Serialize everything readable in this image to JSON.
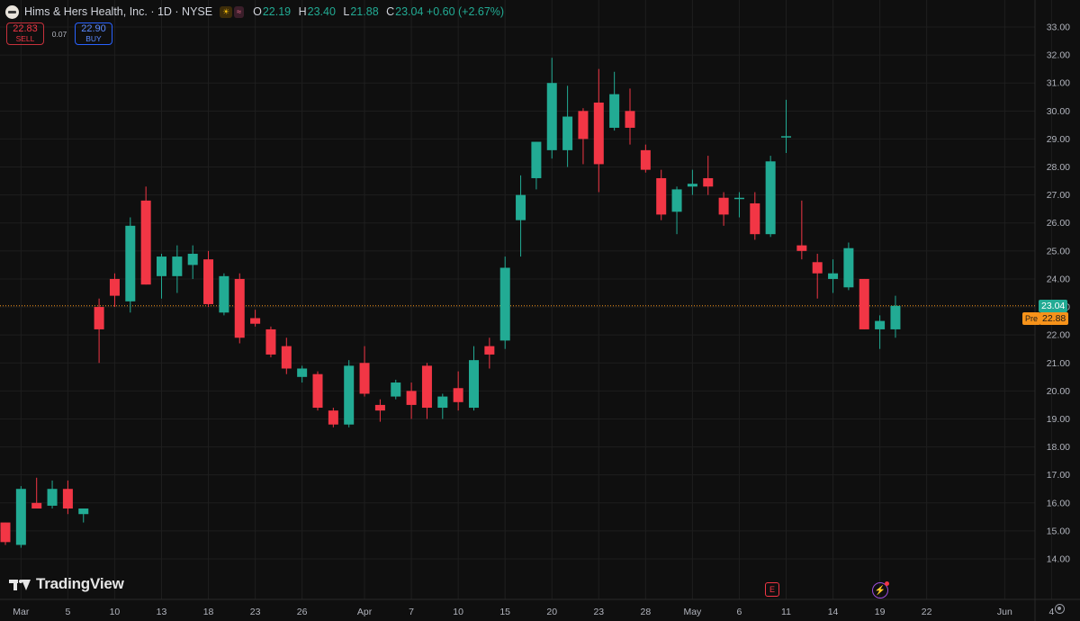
{
  "header": {
    "title": "Hims & Hers Health, Inc. · 1D · NYSE",
    "ohlc": [
      {
        "k": "O",
        "v": "22.19"
      },
      {
        "k": "H",
        "v": "23.40"
      },
      {
        "k": "L",
        "v": "21.88"
      },
      {
        "k": "C",
        "v": "23.04 +0.60 (+2.67%)"
      }
    ]
  },
  "trade": {
    "sell_price": "22.83",
    "sell_label": "SELL",
    "spread": "0.07",
    "buy_price": "22.90",
    "buy_label": "BUY"
  },
  "price_labels": {
    "last": "23.04",
    "pre_tag": "Pre",
    "pre": "22.88"
  },
  "branding": {
    "logo_text": "TradingView"
  },
  "events": {
    "earnings": "E"
  },
  "colors": {
    "up": "#22ab94",
    "down": "#f23645",
    "background": "#0f0f0f",
    "grid": "#1e1e1e",
    "pre": "#f7931a"
  },
  "chart_data": {
    "type": "candlestick",
    "ylim": [
      13.5,
      33.3
    ],
    "y_ticks": [
      "14.00",
      "15.00",
      "16.00",
      "17.00",
      "18.00",
      "19.00",
      "20.00",
      "21.00",
      "22.00",
      "23.00",
      "24.00",
      "25.00",
      "26.00",
      "27.00",
      "28.00",
      "29.00",
      "30.00",
      "31.00",
      "32.00",
      "33.00"
    ],
    "x_ticks": [
      {
        "i": 1,
        "label": "Mar"
      },
      {
        "i": 4,
        "label": "5"
      },
      {
        "i": 7,
        "label": "10"
      },
      {
        "i": 10,
        "label": "13"
      },
      {
        "i": 13,
        "label": "18"
      },
      {
        "i": 16,
        "label": "23"
      },
      {
        "i": 19,
        "label": "26"
      },
      {
        "i": 23,
        "label": "Apr"
      },
      {
        "i": 26,
        "label": "7"
      },
      {
        "i": 29,
        "label": "10"
      },
      {
        "i": 32,
        "label": "15"
      },
      {
        "i": 35,
        "label": "20"
      },
      {
        "i": 38,
        "label": "23"
      },
      {
        "i": 41,
        "label": "28"
      },
      {
        "i": 44,
        "label": "May"
      },
      {
        "i": 47,
        "label": "6"
      },
      {
        "i": 50,
        "label": "11"
      },
      {
        "i": 53,
        "label": "14"
      },
      {
        "i": 56,
        "label": "19"
      },
      {
        "i": 59,
        "label": "22"
      },
      {
        "i": 64,
        "label": "Jun"
      },
      {
        "i": 67,
        "label": "4"
      }
    ],
    "candles": [
      [
        15.3,
        15.3,
        14.5,
        14.6
      ],
      [
        14.5,
        16.6,
        14.4,
        16.5
      ],
      [
        16.0,
        16.9,
        15.8,
        15.8
      ],
      [
        15.9,
        16.8,
        15.8,
        16.5
      ],
      [
        16.5,
        16.8,
        15.6,
        15.8
      ],
      [
        15.6,
        15.8,
        15.3,
        15.8
      ],
      [
        23.0,
        23.3,
        21.0,
        22.2
      ],
      [
        24.0,
        24.2,
        23.0,
        23.4
      ],
      [
        23.2,
        26.2,
        22.8,
        25.9
      ],
      [
        26.8,
        27.3,
        23.8,
        23.8
      ],
      [
        24.1,
        24.9,
        23.3,
        24.8
      ],
      [
        24.1,
        25.2,
        23.5,
        24.8
      ],
      [
        24.5,
        25.2,
        24.0,
        24.9
      ],
      [
        24.7,
        25.0,
        23.0,
        23.1
      ],
      [
        22.8,
        24.2,
        22.7,
        24.1
      ],
      [
        24.0,
        24.2,
        21.7,
        21.9
      ],
      [
        22.6,
        22.9,
        22.3,
        22.4
      ],
      [
        22.2,
        22.3,
        21.2,
        21.3
      ],
      [
        21.6,
        21.9,
        20.6,
        20.8
      ],
      [
        20.5,
        20.9,
        20.3,
        20.8
      ],
      [
        20.6,
        20.7,
        19.3,
        19.4
      ],
      [
        19.3,
        19.4,
        18.7,
        18.8
      ],
      [
        18.8,
        21.1,
        18.7,
        20.9
      ],
      [
        21.0,
        21.6,
        19.8,
        19.9
      ],
      [
        19.5,
        19.7,
        18.9,
        19.3
      ],
      [
        19.8,
        20.4,
        19.7,
        20.3
      ],
      [
        20.0,
        20.3,
        19.0,
        19.5
      ],
      [
        20.9,
        21.0,
        19.0,
        19.4
      ],
      [
        19.4,
        19.9,
        19.0,
        19.8
      ],
      [
        20.1,
        20.7,
        19.3,
        19.6
      ],
      [
        19.4,
        21.6,
        19.3,
        21.1
      ],
      [
        21.6,
        21.9,
        20.8,
        21.3
      ],
      [
        21.8,
        24.8,
        21.5,
        24.4
      ],
      [
        26.1,
        27.7,
        24.8,
        27.0
      ],
      [
        27.6,
        28.9,
        27.2,
        28.9
      ],
      [
        28.6,
        31.9,
        28.3,
        31.0
      ],
      [
        28.6,
        30.9,
        28.0,
        29.8
      ],
      [
        30.0,
        30.1,
        28.1,
        29.0
      ],
      [
        30.3,
        31.5,
        27.1,
        28.1
      ],
      [
        29.4,
        31.4,
        29.3,
        30.6
      ],
      [
        30.0,
        30.8,
        28.8,
        29.4
      ],
      [
        28.6,
        28.8,
        27.8,
        27.9
      ],
      [
        27.6,
        27.9,
        26.1,
        26.3
      ],
      [
        26.4,
        27.3,
        25.6,
        27.2
      ],
      [
        27.3,
        27.9,
        27.0,
        27.4
      ],
      [
        27.6,
        28.4,
        27.0,
        27.3
      ],
      [
        26.9,
        27.1,
        25.9,
        26.3
      ],
      [
        26.9,
        27.1,
        26.2,
        26.9
      ],
      [
        26.7,
        27.1,
        25.4,
        25.6
      ],
      [
        25.6,
        28.4,
        25.5,
        28.2
      ],
      [
        29.1,
        30.4,
        28.5,
        29.1
      ],
      [
        25.2,
        26.8,
        24.7,
        25.0
      ],
      [
        24.6,
        24.9,
        23.3,
        24.2
      ],
      [
        24.0,
        24.7,
        23.5,
        24.2
      ],
      [
        23.7,
        25.3,
        23.6,
        25.1
      ],
      [
        24.0,
        24.0,
        22.2,
        22.2
      ],
      [
        22.2,
        22.7,
        21.5,
        22.5
      ],
      [
        22.2,
        23.4,
        21.9,
        23.04
      ]
    ],
    "last_price": 23.04,
    "pre_market_price": 22.88
  }
}
